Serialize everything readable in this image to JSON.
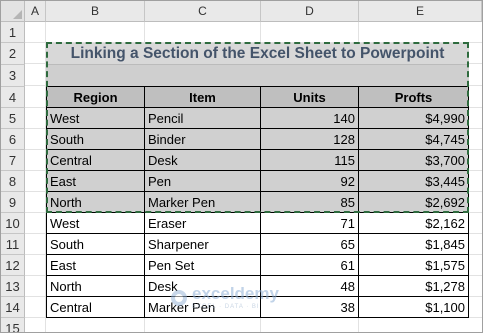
{
  "sheet": {
    "column_headers": [
      "A",
      "B",
      "C",
      "D",
      "E"
    ],
    "row_headers": [
      "1",
      "2",
      "3",
      "4",
      "5",
      "6",
      "7",
      "8",
      "9",
      "10",
      "11",
      "12",
      "13",
      "14",
      "15"
    ],
    "title": "Linking a Section of the Excel Sheet to Powerpoint",
    "table": {
      "headers": [
        "Region",
        "Item",
        "Units",
        "Profts"
      ],
      "rows": [
        [
          "West",
          "Pencil",
          "140",
          "$4,990"
        ],
        [
          "South",
          "Binder",
          "128",
          "$4,745"
        ],
        [
          "Central",
          "Desk",
          "115",
          "$3,700"
        ],
        [
          "East",
          "Pen",
          "92",
          "$3,445"
        ],
        [
          "North",
          "Marker Pen",
          "85",
          "$2,692"
        ],
        [
          "West",
          "Eraser",
          "71",
          "$2,162"
        ],
        [
          "South",
          "Sharpener",
          "65",
          "$1,845"
        ],
        [
          "East",
          "Pen Set",
          "61",
          "$1,575"
        ],
        [
          "North",
          "Desk",
          "48",
          "$1,278"
        ],
        [
          "Central",
          "Marker Pen",
          "38",
          "$1,100"
        ]
      ]
    },
    "copied_rows": 5
  },
  "watermark": {
    "name": "exceldemy",
    "tagline": "EXCEL · DATA · BI"
  },
  "colors": {
    "title_text": "#44546a",
    "selection_border": "#2e6b3e",
    "header_fill": "#bfbfbf",
    "selected_fill": "#d0d0d0"
  }
}
